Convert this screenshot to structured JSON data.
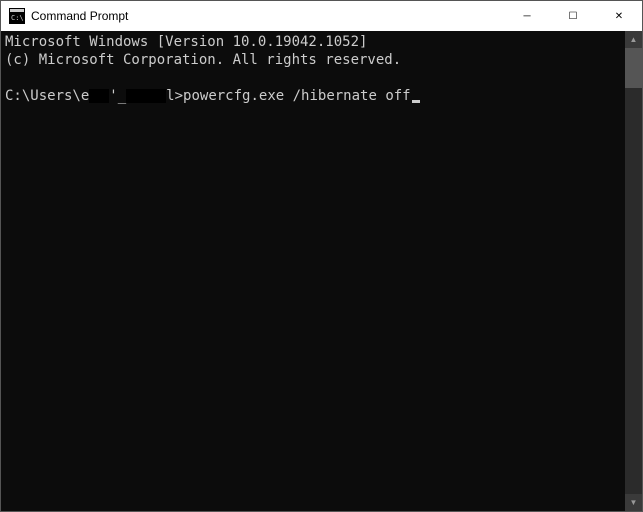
{
  "window": {
    "title": "Command Prompt"
  },
  "terminal": {
    "line1": "Microsoft Windows [Version 10.0.19042.1052]",
    "line2": "(c) Microsoft Corporation. All rights reserved.",
    "prompt_prefix": "C:\\Users\\e",
    "prompt_suffix": ">",
    "command": "powercfg.exe /hibernate off",
    "redacted_fragment_1": "'_",
    "redacted_fragment_2": "l"
  },
  "icons": {
    "minimize": "─",
    "maximize": "☐",
    "close": "✕",
    "scroll_up": "▲",
    "scroll_down": "▼"
  }
}
